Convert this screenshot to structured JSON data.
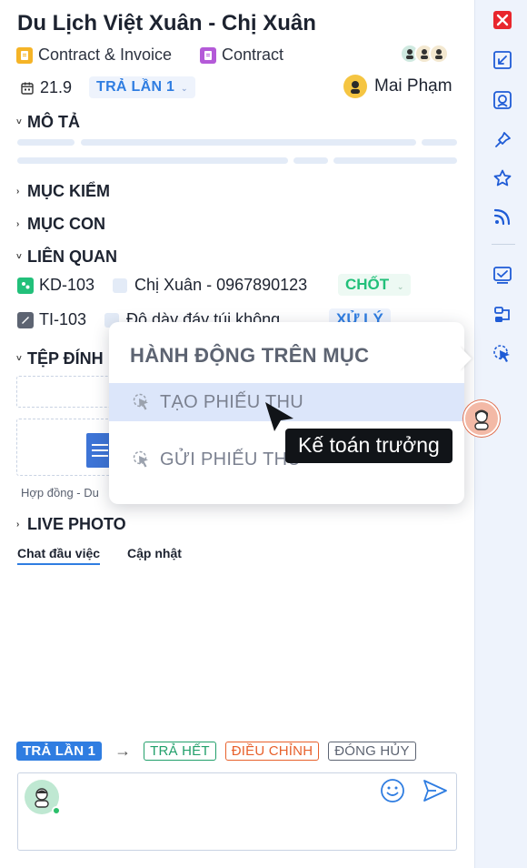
{
  "title": "Du Lịch Việt Xuân - Chị Xuân",
  "tags": [
    {
      "label": "Contract & Invoice",
      "color": "#f5b427"
    },
    {
      "label": "Contract",
      "color": "#b45ad8"
    }
  ],
  "meta": {
    "date": "21.9",
    "stage": "TRẢ LẦN 1",
    "assignee": "Mai Phạm"
  },
  "sections": {
    "description": "MÔ TẢ",
    "checklist": "MỤC KIỂM",
    "subitems": "MỤC CON",
    "related": "LIÊN QUAN",
    "attachments": "TỆP ĐÍNH",
    "live_photo": "LIVE PHOTO"
  },
  "related_items": [
    {
      "code": "KD-103",
      "name": "Chị Xuân - 0967890123",
      "status": "CHỐT",
      "status_color": "#22c07a"
    },
    {
      "code": "TI-103",
      "name": "Độ dày đáy túi không",
      "status": "XỬ LÝ",
      "status_color": "#2f7de1"
    }
  ],
  "attachment": {
    "caption": "Hợp đồng - Du"
  },
  "tabs": {
    "chat": "Chat đầu việc",
    "updates": "Cập nhật"
  },
  "workflow": {
    "current": "TRẢ LẦN 1",
    "arrow": "→",
    "options": [
      {
        "label": "TRẢ HẾT",
        "color": "#22a06b"
      },
      {
        "label": "ĐIỀU CHỈNH",
        "color": "#e8612c"
      },
      {
        "label": "ĐÓNG HỦY",
        "color": "#5d6472"
      }
    ]
  },
  "popup": {
    "title": "HÀNH ĐỘNG TRÊN MỤC",
    "items": [
      "TẠO PHIẾU THU",
      "GỬI PHIẾU THU"
    ]
  },
  "tooltip": {
    "text": "Kế toán trưởng"
  },
  "colors": {
    "accent": "#2f7de1",
    "rail_bg": "#eef3fc",
    "close": "#e8262d"
  },
  "rail_icons": [
    "close-icon",
    "collapse-icon",
    "robot-icon",
    "pin-icon",
    "star-icon",
    "feed-icon",
    "checklist-icon",
    "workflow-icon",
    "action-pointer-icon"
  ]
}
